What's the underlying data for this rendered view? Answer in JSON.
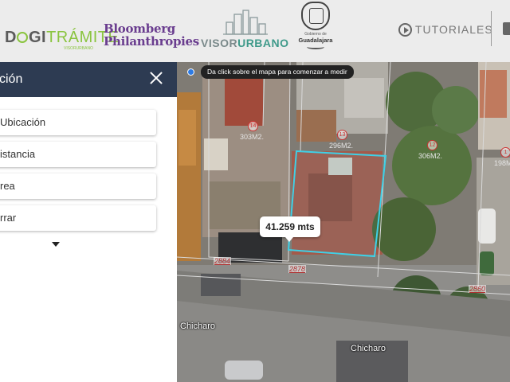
{
  "header": {
    "digitramite": {
      "part1": "D",
      "part2": "GI",
      "part3": "TRÁMITE",
      "sub": "VISORURBANO"
    },
    "bloomberg": {
      "line1": "Bloomberg",
      "line2": "Philanthropies"
    },
    "visor": {
      "part1": "VISOR",
      "part2": "URBANO"
    },
    "gobierno": {
      "line1": "Gobierno de",
      "line2": "Guadalajara"
    },
    "tutoriales_label": "TUTORIALES"
  },
  "panel": {
    "title": "ción",
    "options": [
      {
        "label": "Ubicación"
      },
      {
        "label": "istancia"
      },
      {
        "label": "rea"
      },
      {
        "label": "rrar"
      }
    ]
  },
  "map": {
    "tooltip": "Da click sobre el mapa para comenzar a medir",
    "measurement": "41.259 mts",
    "lots": [
      {
        "num": "14",
        "area": "303M2."
      },
      {
        "num": "13",
        "area": "296M2."
      },
      {
        "num": "12",
        "area": "306M2."
      },
      {
        "num": "1",
        "area": "198M"
      }
    ],
    "street_numbers": [
      "2884",
      "2878",
      "2860"
    ],
    "street_names": [
      "Chicharo",
      "Chicharo"
    ]
  },
  "colors": {
    "panel_header": "#2d3b52",
    "measure_outline": "#3fd0e6",
    "bloomberg": "#6a3d8f",
    "digitramite_accent": "#8ac43f"
  }
}
